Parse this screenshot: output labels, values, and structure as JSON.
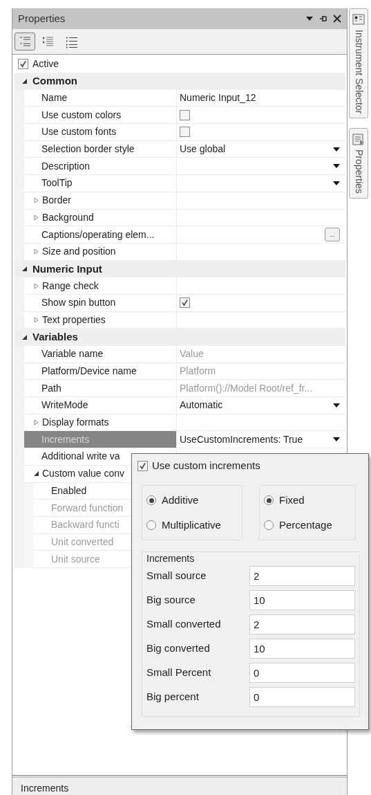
{
  "window": {
    "title": "Properties"
  },
  "toolbar": [
    {
      "selected": true
    },
    {
      "selected": false
    },
    {
      "selected": false
    }
  ],
  "active": {
    "label": "Active",
    "checked": true
  },
  "categories": [
    {
      "name": "Common",
      "expanded": true,
      "items": [
        {
          "kind": "text",
          "name": "Name",
          "value": "Numeric Input_12"
        },
        {
          "kind": "checkbox",
          "name": "Use custom colors",
          "checked": false
        },
        {
          "kind": "checkbox",
          "name": "Use custom fonts",
          "checked": false
        },
        {
          "kind": "dropdown",
          "name": "Selection border style",
          "value": "Use global"
        },
        {
          "kind": "dropdown",
          "name": "Description"
        },
        {
          "kind": "dropdown",
          "name": "ToolTip"
        },
        {
          "kind": "expandable",
          "name": "Border",
          "expanded": false
        },
        {
          "kind": "expandable",
          "name": "Background",
          "expanded": false
        },
        {
          "kind": "ellipsis",
          "name": "Captions/operating elem...",
          "button": "..."
        },
        {
          "kind": "expandable",
          "name": "Size and position",
          "expanded": false
        }
      ]
    },
    {
      "name": "Numeric Input",
      "expanded": true,
      "items": [
        {
          "kind": "expandable",
          "name": "Range check",
          "expanded": false
        },
        {
          "kind": "checkbox",
          "name": "Show spin button",
          "checked": true
        },
        {
          "kind": "expandable",
          "name": "Text properties",
          "expanded": false
        }
      ]
    },
    {
      "name": "Variables",
      "expanded": true,
      "items": [
        {
          "kind": "text",
          "name": "Variable name",
          "value": "Value",
          "readonly": true
        },
        {
          "kind": "text",
          "name": "Platform/Device name",
          "value": "Platform",
          "readonly": true
        },
        {
          "kind": "text",
          "name": "Path",
          "value": "Platform()://Model Root/ref_fr...",
          "readonly": true
        },
        {
          "kind": "dropdown",
          "name": "WriteMode",
          "value": "Automatic"
        },
        {
          "kind": "expandable",
          "name": "Display formats",
          "expanded": false
        },
        {
          "kind": "dropdown",
          "name": "Increments",
          "value": "UseCustomIncrements: True",
          "selected": true
        },
        {
          "name": "Additional write va"
        },
        {
          "kind": "group",
          "name": "Custom value conv",
          "expanded": true,
          "children": [
            {
              "name": "Enabled",
              "disabled": false
            },
            {
              "name": "Forward function",
              "disabled": true
            },
            {
              "name": "Backward functi",
              "disabled": true
            },
            {
              "name": "Unit converted",
              "disabled": true
            },
            {
              "name": "Unit source",
              "disabled": true
            }
          ]
        }
      ]
    }
  ],
  "popup": {
    "checkbox": {
      "label": "Use custom increments",
      "checked": true
    },
    "radio_groups": [
      {
        "options": [
          {
            "label": "Additive",
            "selected": true
          },
          {
            "label": "Multiplicative",
            "selected": false
          }
        ]
      },
      {
        "options": [
          {
            "label": "Fixed",
            "selected": true
          },
          {
            "label": "Percentage",
            "selected": false
          }
        ]
      }
    ],
    "increments": {
      "title": "Increments",
      "fields": [
        {
          "label": "Small source",
          "value": "2"
        },
        {
          "label": "Big source",
          "value": "10"
        },
        {
          "label": "Small converted",
          "value": "2"
        },
        {
          "label": "Big converted",
          "value": "10"
        },
        {
          "label": "Small Percent",
          "value": "0"
        },
        {
          "label": "Big percent",
          "value": "0"
        }
      ]
    }
  },
  "description": {
    "title": "Increments"
  },
  "side_tabs": [
    {
      "label": "Instrument Selector"
    },
    {
      "label": "Properties"
    }
  ]
}
